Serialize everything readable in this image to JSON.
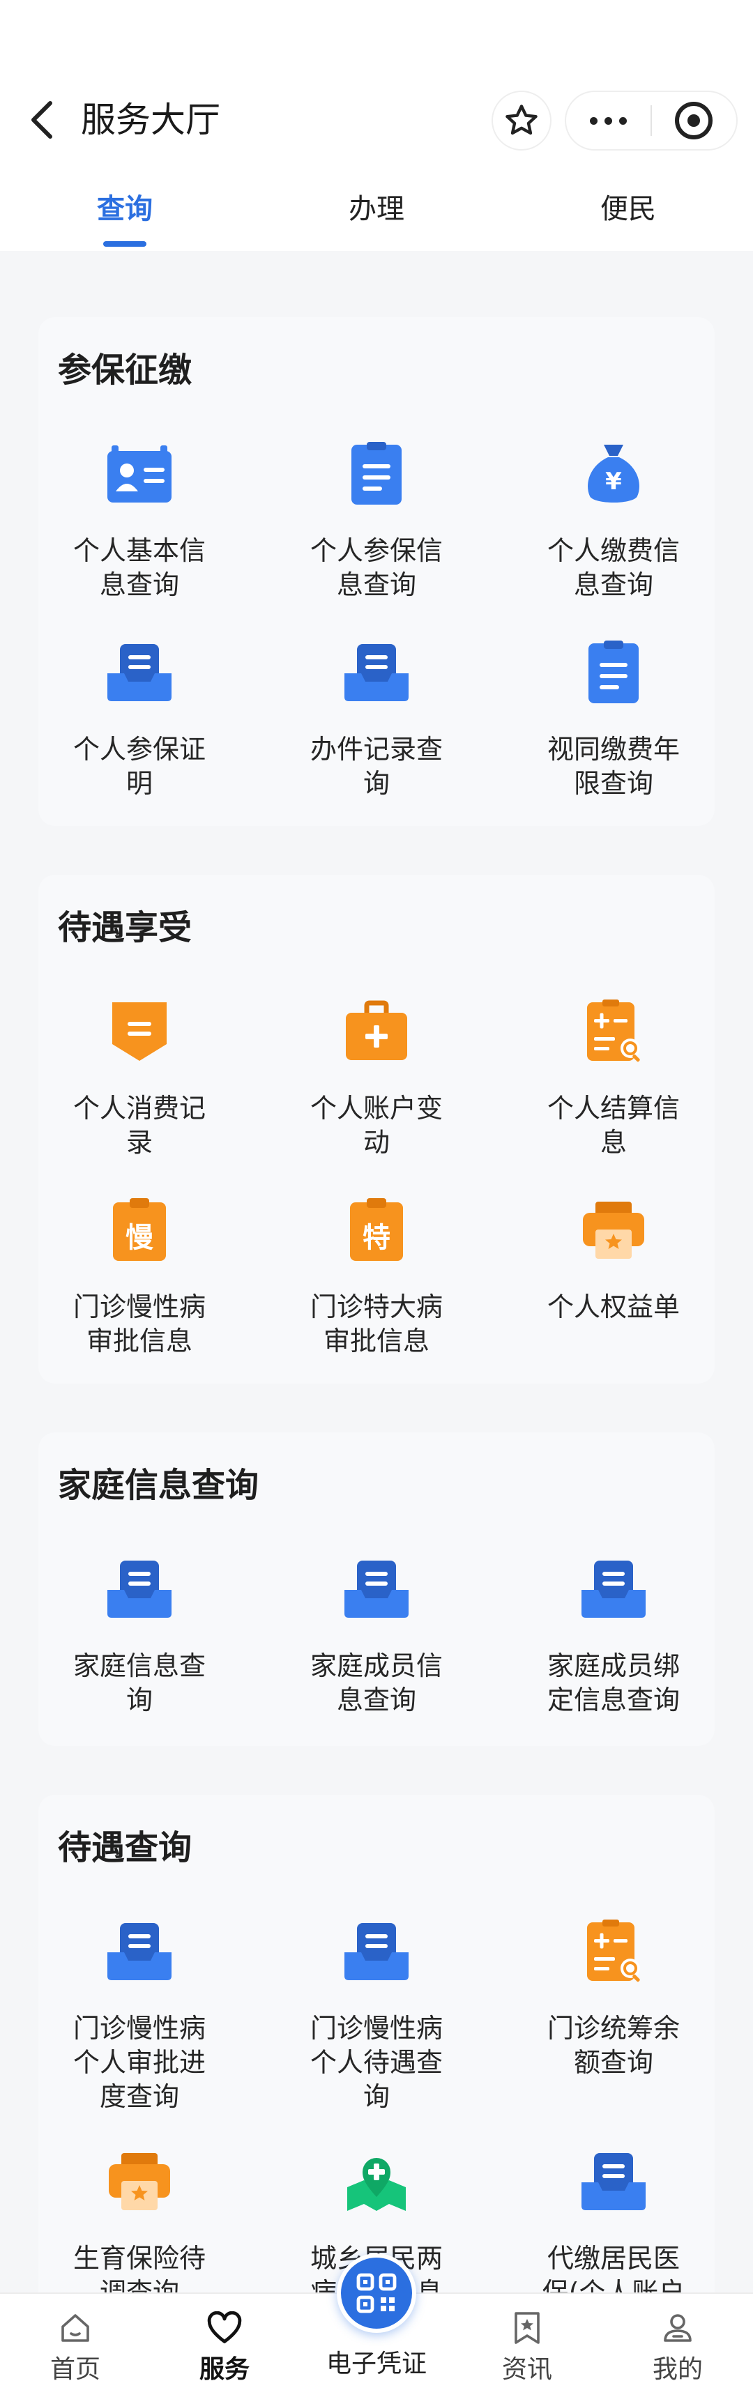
{
  "header": {
    "title": "服务大厅",
    "back_icon": "chevron-left-icon",
    "star_icon": "star-icon",
    "more_icon": "more-dots-icon",
    "close_icon": "target-circle-icon"
  },
  "tabs": [
    {
      "label": "查询",
      "active": true
    },
    {
      "label": "办理",
      "active": false
    },
    {
      "label": "便民",
      "active": false
    }
  ],
  "colors": {
    "accent": "#2b6fe0",
    "blue_icon": "#3a7ff0",
    "orange_icon": "#f7931e",
    "green_icon": "#16c47a",
    "background": "#f5f6f8"
  },
  "sections": [
    {
      "title": "参保征缴",
      "items": [
        {
          "label_line1": "个人基本信",
          "label_line2": "息查询",
          "icon": "id-card-icon",
          "color": "blue"
        },
        {
          "label_line1": "个人参保信",
          "label_line2": "息查询",
          "icon": "document-list-icon",
          "color": "blue"
        },
        {
          "label_line1": "个人缴费信",
          "label_line2": "息查询",
          "icon": "money-bag-icon",
          "color": "blue"
        },
        {
          "label_line1": "个人参保证",
          "label_line2": "明",
          "icon": "inbox-document-icon",
          "color": "blue"
        },
        {
          "label_line1": "办件记录查",
          "label_line2": "询",
          "icon": "inbox-document-icon",
          "color": "blue"
        },
        {
          "label_line1": "视同缴费年",
          "label_line2": "限查询",
          "icon": "clipboard-icon",
          "color": "blue"
        }
      ]
    },
    {
      "title": "待遇享受",
      "items": [
        {
          "label_line1": "个人消费记",
          "label_line2": "录",
          "icon": "banner-tag-icon",
          "color": "orange"
        },
        {
          "label_line1": "个人账户变",
          "label_line2": "动",
          "icon": "medical-kit-icon",
          "color": "orange"
        },
        {
          "label_line1": "个人结算信",
          "label_line2": "息",
          "icon": "calculator-search-icon",
          "color": "orange"
        },
        {
          "label_line1": "门诊慢性病",
          "label_line2": "审批信息",
          "icon": "clipboard-slow-icon",
          "glyph": "慢",
          "color": "orange"
        },
        {
          "label_line1": "门诊特大病",
          "label_line2": "审批信息",
          "icon": "clipboard-special-icon",
          "glyph": "特",
          "color": "orange"
        },
        {
          "label_line1": "个人权益单",
          "label_line2": "",
          "icon": "printer-star-icon",
          "color": "orange"
        }
      ]
    },
    {
      "title": "家庭信息查询",
      "items": [
        {
          "label_line1": "家庭信息查",
          "label_line2": "询",
          "icon": "inbox-document-icon",
          "color": "blue"
        },
        {
          "label_line1": "家庭成员信",
          "label_line2": "息查询",
          "icon": "inbox-document-icon",
          "color": "blue"
        },
        {
          "label_line1": "家庭成员绑",
          "label_line2": "定信息查询",
          "icon": "inbox-document-icon",
          "color": "blue"
        }
      ]
    },
    {
      "title": "待遇查询",
      "items": [
        {
          "label_line1": "门诊慢性病",
          "label_line2": "个人审批进",
          "label_line3": "度查询",
          "icon": "inbox-document-icon",
          "color": "blue"
        },
        {
          "label_line1": "门诊慢性病",
          "label_line2": "个人待遇查",
          "label_line3": "询",
          "icon": "inbox-document-icon",
          "color": "blue"
        },
        {
          "label_line1": "门诊统筹余",
          "label_line2": "额查询",
          "icon": "calculator-search-icon",
          "color": "orange"
        },
        {
          "label_line1": "生育保险待",
          "label_line2": "调查询",
          "icon": "printer-star-icon",
          "color": "orange"
        },
        {
          "label_line1": "城乡居民两",
          "label_line2": "病门诊信息",
          "icon": "map-pin-plus-icon",
          "color": "green"
        },
        {
          "label_line1": "代缴居民医",
          "label_line2": "保(个人账户",
          "icon": "inbox-document-icon",
          "color": "blue"
        }
      ]
    }
  ],
  "bottom_nav": [
    {
      "label": "首页",
      "icon": "home-icon",
      "active": false
    },
    {
      "label": "服务",
      "icon": "heart-icon",
      "active": true
    },
    {
      "label": "电子凭证",
      "icon": "qr-code-icon",
      "active": false
    },
    {
      "label": "资讯",
      "icon": "bookmark-star-icon",
      "active": false
    },
    {
      "label": "我的",
      "icon": "user-icon",
      "active": false
    }
  ]
}
